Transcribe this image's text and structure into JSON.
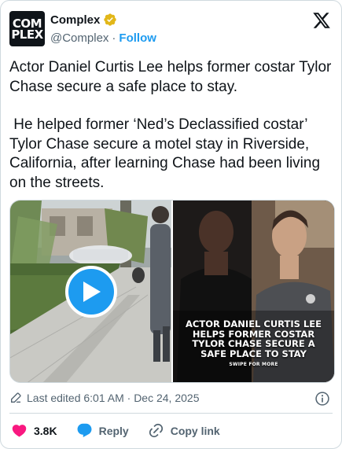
{
  "author": {
    "avatar_text_line1": "COM",
    "avatar_text_line2": "PLEX",
    "display_name": "Complex",
    "handle": "@Complex",
    "separator": "·",
    "follow_label": "Follow"
  },
  "tweet": {
    "paragraph1": "Actor Daniel Curtis Lee helps former costar Tylor Chase secure a safe place to stay.",
    "paragraph2": " He helped former ‘Ned’s Declassified costar’ Tylor Chase secure a motel stay in Riverside, California, after learning Chase had been living on the streets."
  },
  "media": {
    "caption": "ACTOR DANIEL CURTIS LEE HELPS FORMER COSTAR TYLOR CHASE SECURE A SAFE PLACE TO STAY",
    "swipe": "SWIPE FOR MORE"
  },
  "meta": {
    "edited": "Last edited 6:01 AM · Dec 24, 2025"
  },
  "actions": {
    "likes": "3.8K",
    "reply": "Reply",
    "copy_link": "Copy link"
  },
  "colors": {
    "accent": "#1d9bf0",
    "like": "#f91880",
    "verified": "#e2b719"
  }
}
